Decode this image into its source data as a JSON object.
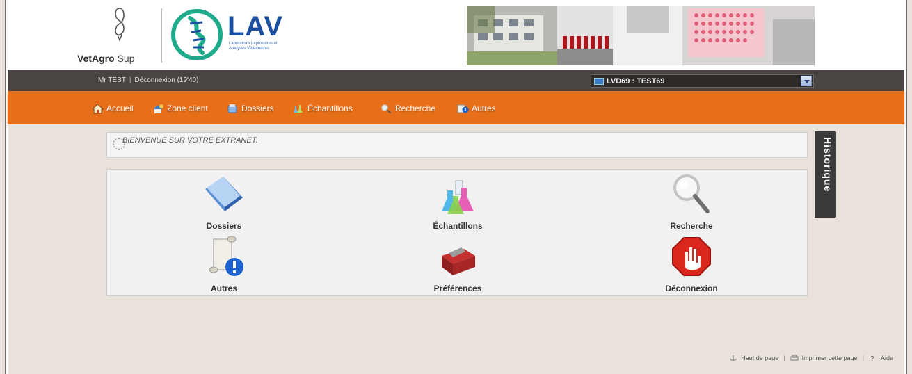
{
  "logos": {
    "vetagro_name": "VetAgro",
    "vetagro_sup": "Sup",
    "lav_name": "LAV",
    "lav_subtitle": "Laboratoire Leptospires et Analyses Vétérinaires"
  },
  "userbar": {
    "user": "Mr TEST",
    "logout": "Déconnexion (19'40)",
    "account_selected": "LVD69 : TEST69"
  },
  "nav": {
    "items": [
      {
        "label": "Accueil",
        "icon": "home-icon"
      },
      {
        "label": "Zone client",
        "icon": "client-zone-icon"
      },
      {
        "label": "Dossiers",
        "icon": "folders-icon"
      },
      {
        "label": "Échantillons",
        "icon": "samples-icon"
      },
      {
        "label": "Recherche",
        "icon": "search-icon"
      },
      {
        "label": "Autres",
        "icon": "others-icon"
      }
    ]
  },
  "welcome": {
    "message": "BIENVENUE SUR VOTRE EXTRANET."
  },
  "tiles": [
    {
      "label": "Dossiers",
      "icon": "folder-icon"
    },
    {
      "label": "Échantillons",
      "icon": "flasks-icon"
    },
    {
      "label": "Recherche",
      "icon": "magnifier-icon"
    },
    {
      "label": "Autres",
      "icon": "scroll-info-icon"
    },
    {
      "label": "Préférences",
      "icon": "toolbox-icon"
    },
    {
      "label": "Déconnexion",
      "icon": "stop-hand-icon"
    }
  ],
  "side_tab": {
    "label": "Historique"
  },
  "footer": {
    "top": "Haut de page",
    "print": "Imprimer cette page",
    "help": "Aide"
  },
  "colors": {
    "nav_orange": "#e86f1a",
    "userbar_dark": "#4a4542",
    "content_bg": "#e8e2da",
    "lav_blue": "#1a4fa0",
    "lav_teal": "#1faa8c"
  }
}
